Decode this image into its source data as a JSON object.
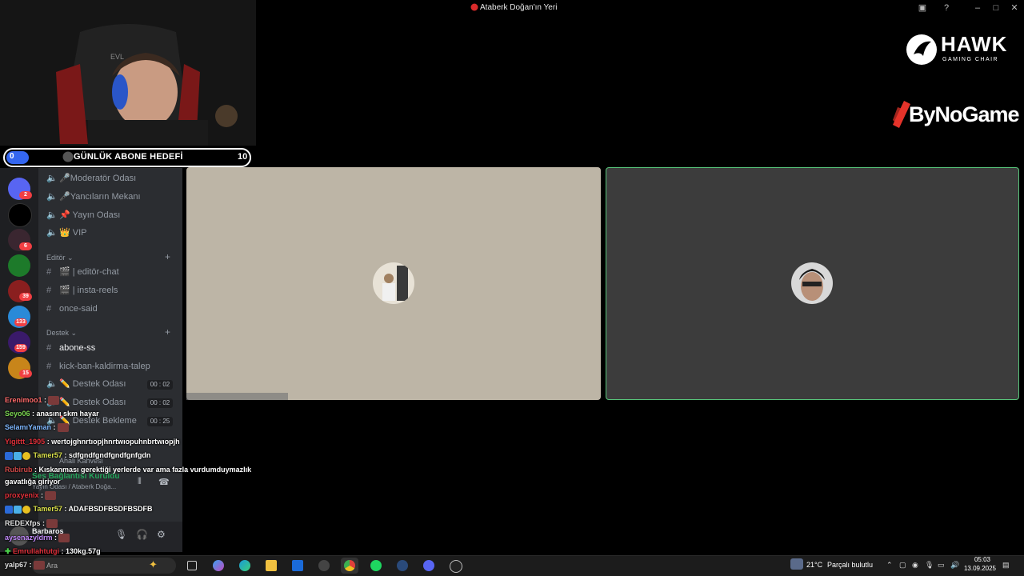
{
  "window": {
    "title": "Ataberk Doğan'ın Yeri"
  },
  "sponsors": {
    "hawk_main": "HAWK",
    "hawk_sub": "GAMING CHAIR",
    "bynogame": "ByNoGame"
  },
  "goal": {
    "start": "0",
    "label": "GÜNLÜK ABONE HEDEFİ",
    "end": "10",
    "progress": 0.0
  },
  "webcam": {
    "chair_text": "EVL"
  },
  "servers": [
    {
      "badge": "2"
    },
    {
      "badge": ""
    },
    {
      "badge": "6"
    },
    {
      "badge": ""
    },
    {
      "badge": "39"
    },
    {
      "badge": "133"
    },
    {
      "badge": "159"
    },
    {
      "badge": "15"
    }
  ],
  "channels": {
    "top": [
      {
        "icon": "speaker-icon",
        "label": "🎤Moderatör Odası"
      },
      {
        "icon": "speaker-icon",
        "label": "🎤Yancıların Mekanı"
      },
      {
        "icon": "speaker-icon",
        "label": "📌 Yayın Odası"
      },
      {
        "icon": "speaker-icon",
        "label": "👑 VIP"
      }
    ],
    "editor_category": "Editör",
    "editor": [
      {
        "icon": "hash-icon",
        "label": "🎬 | editör-chat"
      },
      {
        "icon": "hash-icon",
        "label": "🎬 | insta-reels"
      },
      {
        "icon": "hash-icon",
        "label": "once-said"
      }
    ],
    "support_category": "Destek",
    "support": [
      {
        "icon": "hash-icon",
        "label": "abone-ss",
        "active": true
      },
      {
        "icon": "hash-icon",
        "label": "kick-ban-kaldirma-talep"
      },
      {
        "icon": "speaker-icon",
        "label": "✏️ Destek Odası",
        "timer": "00 : 02"
      },
      {
        "icon": "speaker-icon",
        "label": "✏️ Destek Odası",
        "timer": "00 : 02"
      },
      {
        "icon": "speaker-icon",
        "label": "✏️ Destek Bekleme",
        "timer": "00 : 25"
      },
      {
        "icon": "speaker-icon",
        "label": "Ahali Kahvesi"
      }
    ],
    "voice_status": "Ses Bağlantısı Kuruldu",
    "voice_channel": "Yayın Odası / Ataberk Doğa..."
  },
  "user": {
    "name": "Barbaros"
  },
  "chat": [
    {
      "user": "Erenimoo1",
      "color": "#ff6b6b",
      "text": " :",
      "emote": true
    },
    {
      "user": "Seyo06",
      "color": "#7bd651",
      "text": " : anasını skm hayar"
    },
    {
      "user": "SelamıYaman",
      "color": "#7fb8ff",
      "text": " :",
      "emote": true
    },
    {
      "user": "Yigittt_1905",
      "color": "#e0303a",
      "text": " : wertojghnrtıopjhnrtwıopuhnbrtwıopjh"
    },
    {
      "user": "Tamer57",
      "color": "#d9e04a",
      "text": " : sdfgndfgndfgndfgnfgdn",
      "badges": true
    },
    {
      "user": "Rubirub",
      "color": "#d04848",
      "text": " : Kıskanması gerektiği yerlerde var ama fazla vurdumduymazlık"
    },
    {
      "user": "",
      "color": "#fff",
      "text": "gavatlığa giriyor"
    },
    {
      "user": "proxyenix",
      "color": "#e0303a",
      "text": " :",
      "emote": true
    },
    {
      "user": "Tamer57",
      "color": "#d9e04a",
      "text": " : ADAFBSDFBSDFBSDFB",
      "badges": true
    },
    {
      "user": "REDEXfps",
      "color": "#e0e0e0",
      "text": " :",
      "emote": true
    },
    {
      "user": "aysenazyldrm",
      "color": "#c58cff",
      "text": " :",
      "emote": true
    },
    {
      "user": "Emrullahtutgi",
      "color": "#e0303a",
      "text": " : 130kg.57g"
    },
    {
      "user": "yalp67",
      "color": "#e0e0e0",
      "text": " :",
      "emote": true
    }
  ],
  "taskbar": {
    "search_placeholder": "Ara",
    "temperature": "21°C",
    "weather": "Parçalı bulutlu",
    "time": "05:03",
    "date": "13.09.2025"
  },
  "colors": {
    "discord_bg": "#2b2d31",
    "rail_bg": "#1e1f22",
    "speaking_green": "#57c57a",
    "goal_fill": "#3466f0"
  }
}
